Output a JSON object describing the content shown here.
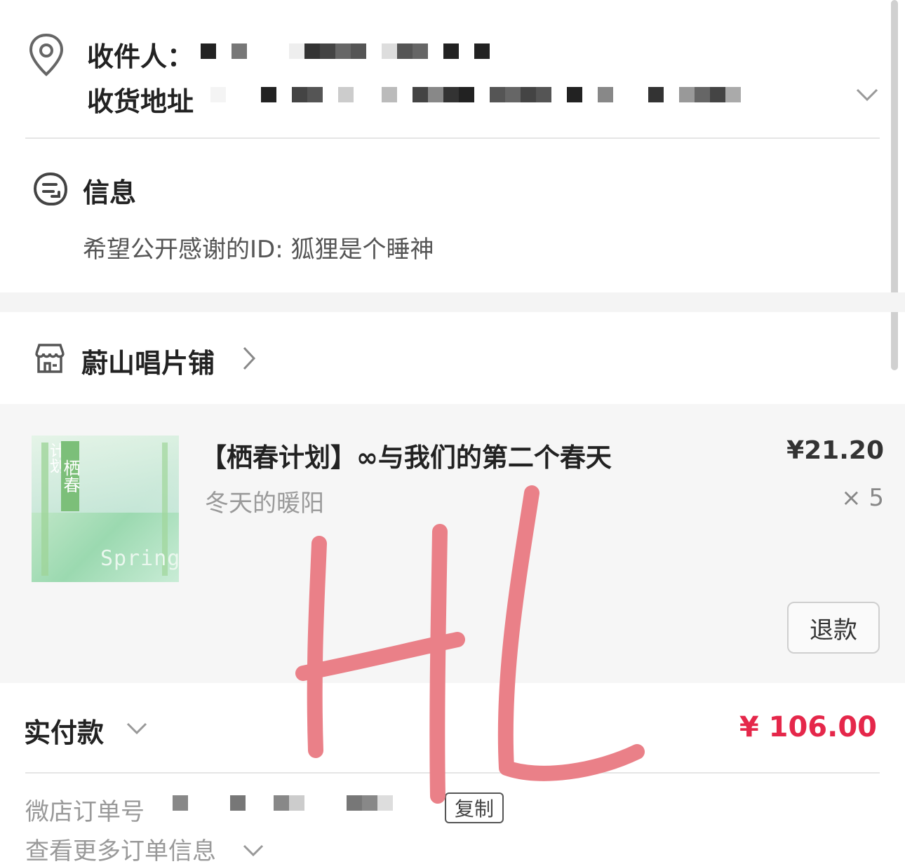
{
  "address": {
    "recipient_label": "收件人：",
    "address_label": "收货地址"
  },
  "info": {
    "title": "信息",
    "message": "希望公开感谢的ID: 狐狸是个睡神"
  },
  "shop": {
    "name": "蔚山唱片铺"
  },
  "product": {
    "title": "【栖春计划】∞与我们的第二个春天",
    "variant": "冬天的暖阳",
    "price": "¥21.20",
    "quantity": "× 5",
    "cover_title": "栖春",
    "cover_side": "计划",
    "cover_word": "Spring",
    "refund_label": "退款"
  },
  "payment": {
    "paid_label": "实付款",
    "total": "¥ 106.00"
  },
  "order": {
    "order_no_label": "微店订单号",
    "copy_label": "复制",
    "more_label": "查看更多订单信息"
  },
  "colors": {
    "accent": "#e5274a",
    "handwriting": "#ea8088"
  }
}
